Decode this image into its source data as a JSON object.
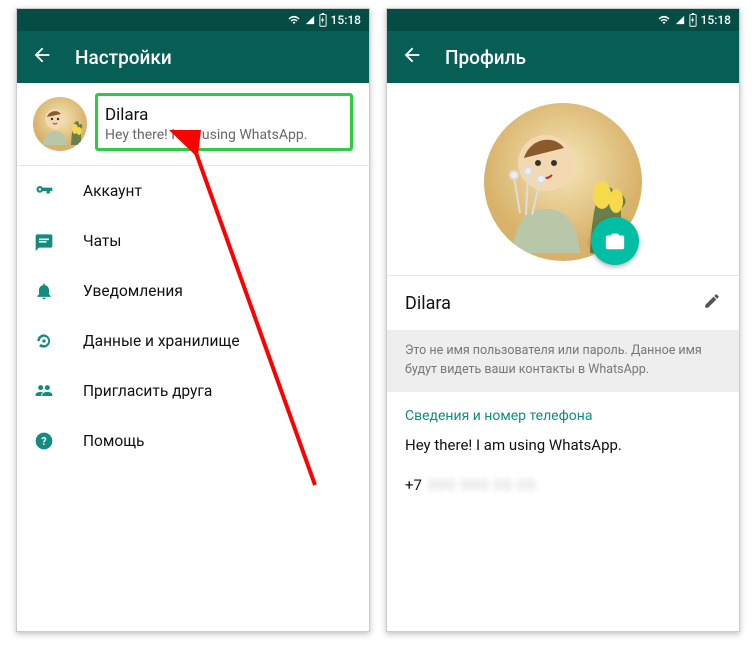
{
  "statusbar": {
    "time": "15:18"
  },
  "settings": {
    "title": "Настройки",
    "profile": {
      "name": "Dilara",
      "status": "Hey there! I am using WhatsApp."
    },
    "items": [
      {
        "label": "Аккаунт"
      },
      {
        "label": "Чаты"
      },
      {
        "label": "Уведомления"
      },
      {
        "label": "Данные и хранилище"
      },
      {
        "label": "Пригласить друга"
      },
      {
        "label": "Помощь"
      }
    ]
  },
  "profile": {
    "title": "Профиль",
    "name": "Dilara",
    "hint": "Это не имя пользователя или пароль. Данное имя будут видеть ваши контакты в WhatsApp.",
    "infoLabel": "Сведения и номер телефона",
    "about": "Hey there! I am using WhatsApp.",
    "phonePrefix": "+7",
    "phoneMasked": "000 000 00 00"
  },
  "colors": {
    "primary": "#075e55",
    "primaryDark": "#054d44",
    "accent": "#128c7e",
    "fab": "#00bfa5"
  }
}
